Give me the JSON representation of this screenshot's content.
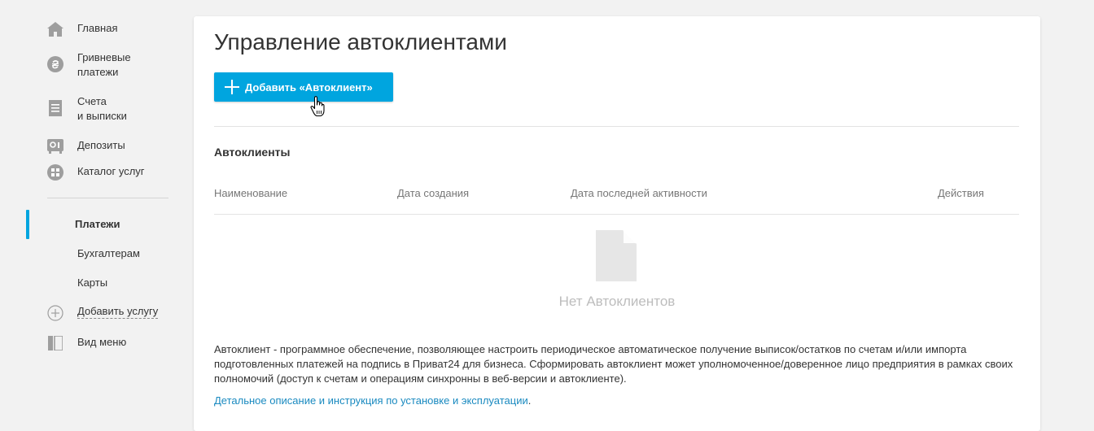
{
  "sidebar": {
    "items": [
      {
        "label": "Главная",
        "icon": "home-icon"
      },
      {
        "label": "Гривневые\nплатежи",
        "icon": "hryvnia-icon"
      },
      {
        "label": "Счета\nи выписки",
        "icon": "document-icon"
      },
      {
        "label": "Депозиты",
        "icon": "deposit-icon"
      },
      {
        "label": "Каталог услуг",
        "icon": "grid-icon"
      }
    ],
    "sub_items": [
      {
        "label": "Платежи",
        "active": true
      },
      {
        "label": "Бухгалтерам",
        "active": false
      },
      {
        "label": "Карты",
        "active": false
      }
    ],
    "add_service": "Добавить услугу",
    "view_menu": "Вид меню",
    "accent_color": "#00a5df"
  },
  "main": {
    "title": "Управление автоклиентами",
    "add_button": "Добавить «Автоклиент»",
    "section_title": "Автоклиенты",
    "columns": [
      "Наименование",
      "Дата создания",
      "Дата последней активности",
      "Действия"
    ],
    "empty_text": "Нет Автоклиентов",
    "description": "Автоклиент - программное обеспечение, позволяющее настроить периодическое автоматическое получение выписок/остатков по счетам и/или импорта подготовленных платежей на подпись в Приват24 для бизнеса. Сформировать автоклиент может уполномоченное/доверенное лицо предприятия в рамках своих полномочий (доступ к счетам и операциям синхронны в веб-версии и автоклиенте).",
    "link_text": "Детальное описание и инструкция по установке и эксплуатации",
    "link_suffix": "."
  }
}
